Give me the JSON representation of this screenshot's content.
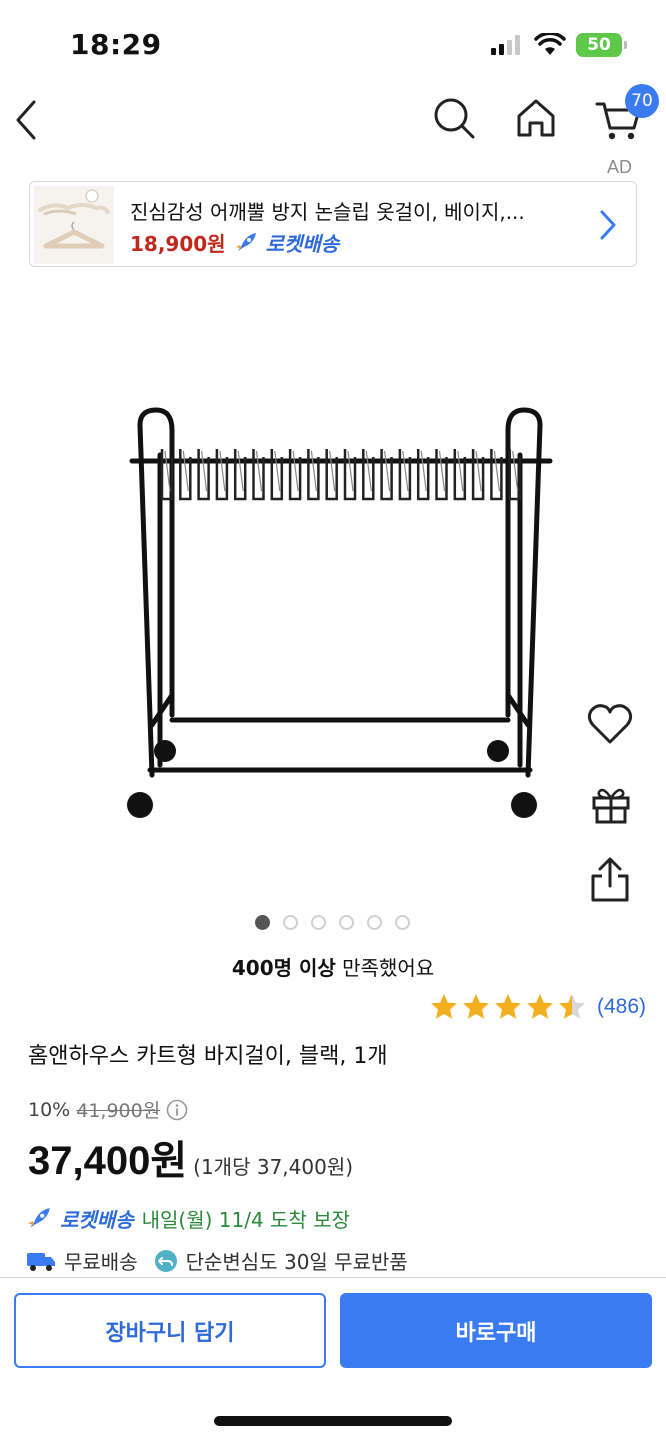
{
  "status_bar": {
    "time": "18:29",
    "battery": "50"
  },
  "nav": {
    "cart_count": "70"
  },
  "ad": {
    "label": "AD",
    "title": "진심감성 어깨뿔 방지 논슬립 옷걸이, 베이지,...",
    "price": "18,900원",
    "delivery_badge": "로켓배송"
  },
  "gallery": {
    "total_images": 6,
    "active_index": 1
  },
  "satisfaction": {
    "strong": "400명 이상",
    "rest": " 만족했어요"
  },
  "rating": {
    "stars": 4.5,
    "count": "(486)"
  },
  "product": {
    "title": "홈앤하우스 카트형 바지걸이, 블랙, 1개",
    "discount": "10%",
    "original_price": "41,900원",
    "sale_price": "37,400원",
    "unit_price": "(1개당 37,400원)"
  },
  "delivery": {
    "badge": "로켓배송",
    "eta": "내일(월) 11/4 도착 보장"
  },
  "benefits": {
    "free_shipping": "무료배송",
    "free_return": "단순변심도 30일 무료반품"
  },
  "buttons": {
    "add_to_cart": "장바구니 담기",
    "buy_now": "바로구매"
  },
  "colors": {
    "accent_blue": "#3a7bf2",
    "price_red": "#c0281b",
    "delivery_green": "#2a8a3a",
    "star_gold": "#f2b01e"
  }
}
